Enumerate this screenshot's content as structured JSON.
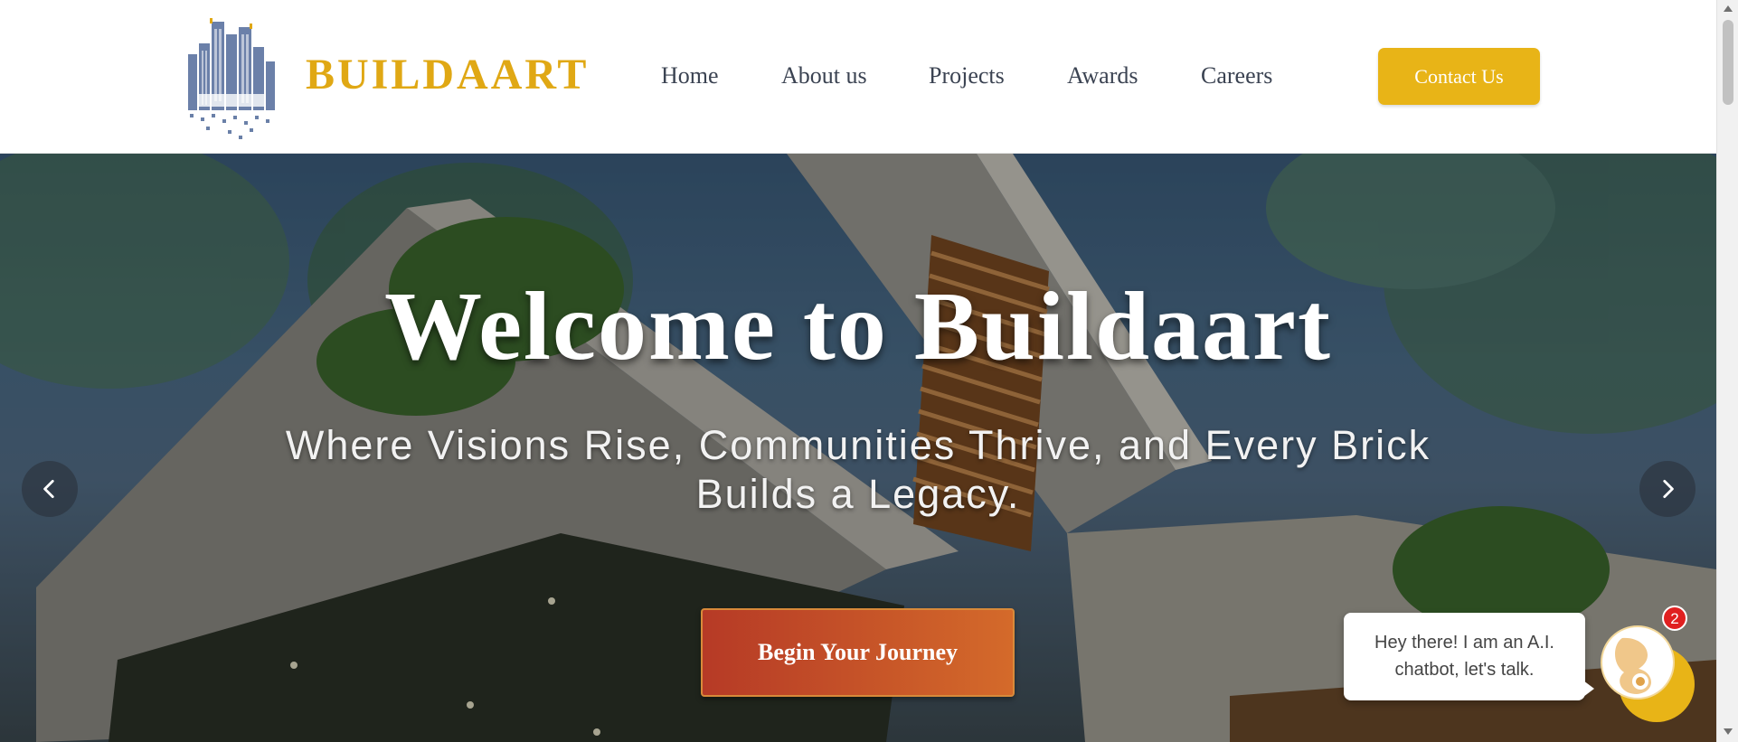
{
  "brand": {
    "name": "BUILDAART",
    "logo_text": "BUILDAART"
  },
  "nav": {
    "items": [
      {
        "label": "Home"
      },
      {
        "label": "About us"
      },
      {
        "label": "Projects"
      },
      {
        "label": "Awards"
      },
      {
        "label": "Careers"
      }
    ],
    "contact_label": "Contact Us"
  },
  "hero": {
    "title": "Welcome to Buildaart",
    "subtitle": "Where Visions Rise, Communities Thrive, and Every Brick Builds a Legacy.",
    "cta_label": "Begin Your Journey",
    "prev_icon": "chevron-left-icon",
    "next_icon": "chevron-right-icon"
  },
  "chatbot": {
    "message": "Hey there! I am an A.I. chatbot, let's talk.",
    "badge_count": "2"
  },
  "colors": {
    "brand_gold": "#e0a814",
    "button_gold": "#e8b417",
    "cta_start": "#b63a26",
    "cta_end": "#d46a2a",
    "nav_text": "#3b4352"
  }
}
